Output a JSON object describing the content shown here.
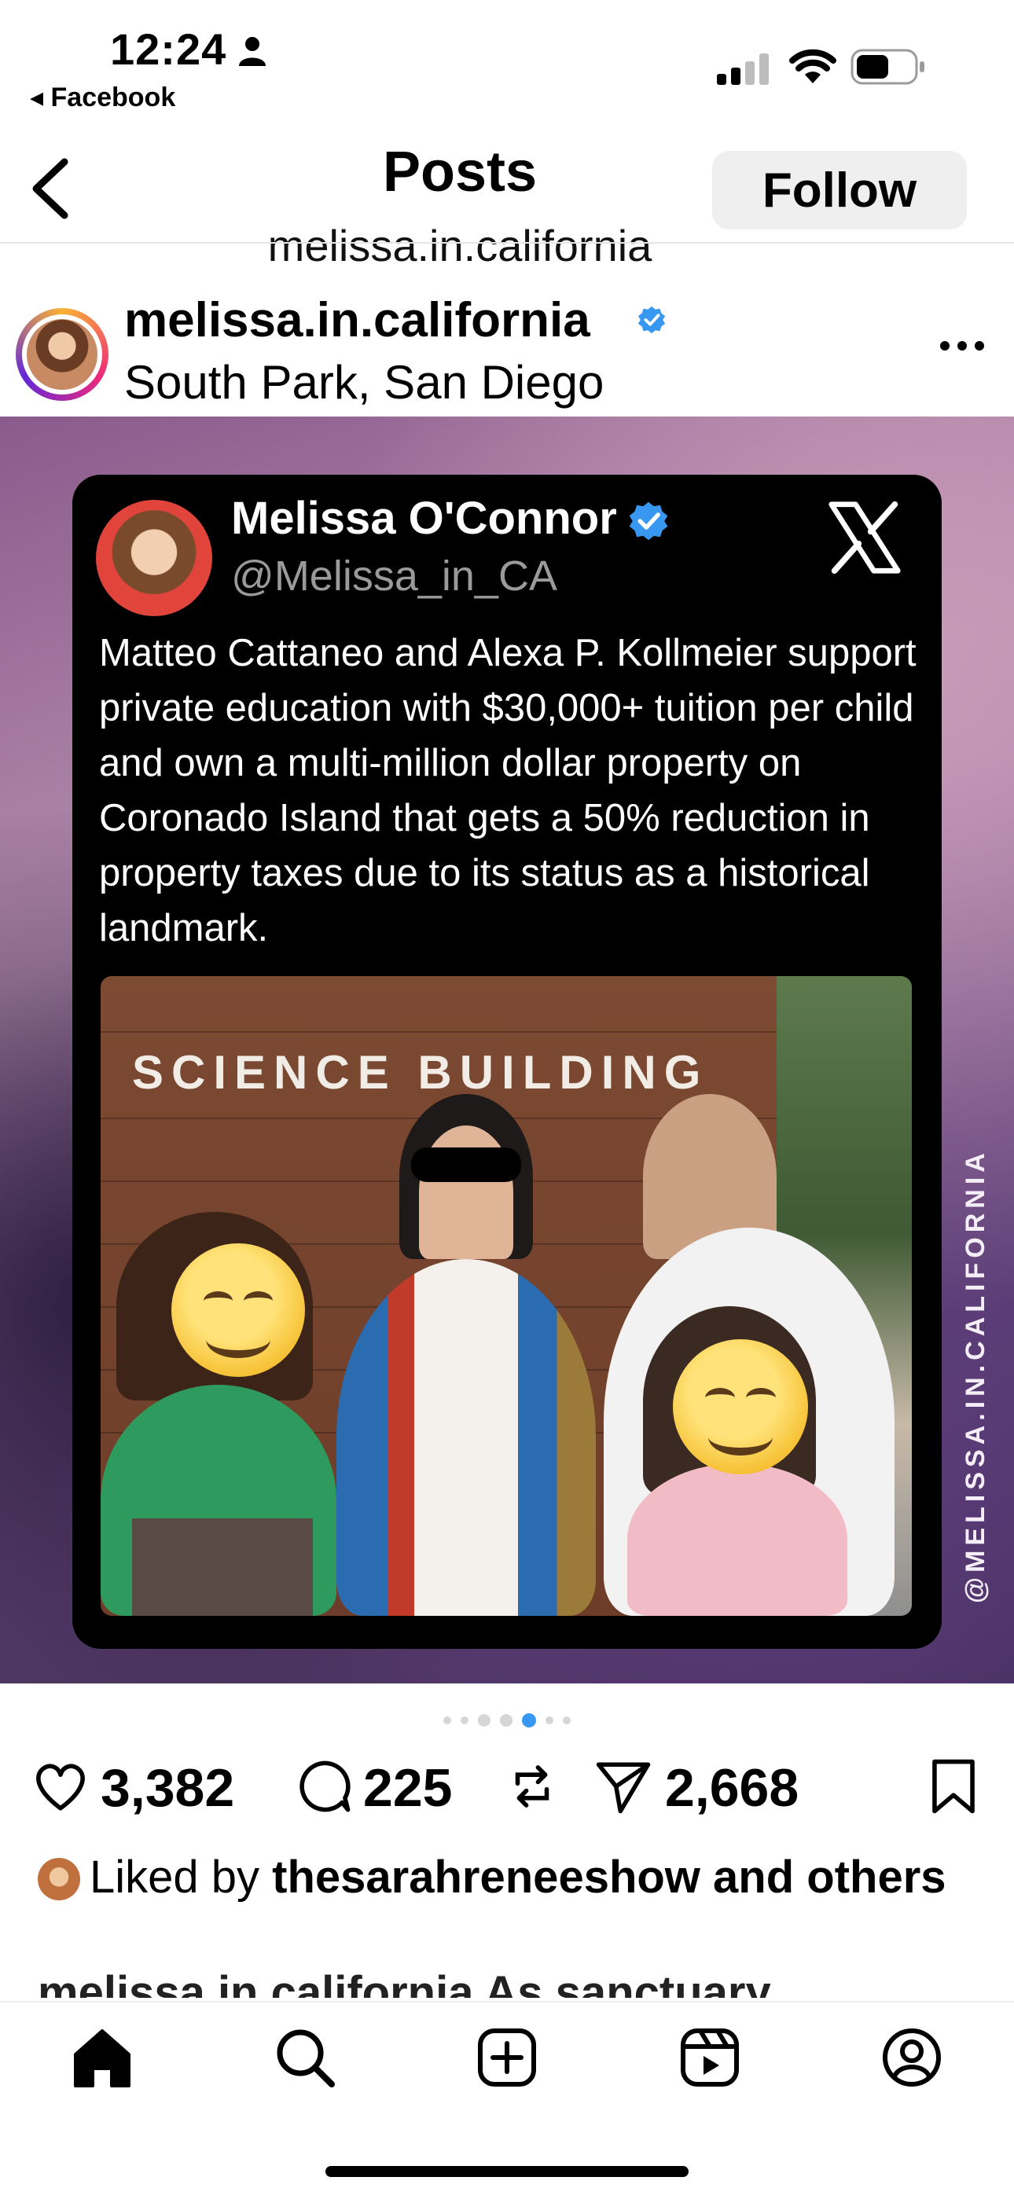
{
  "status_bar": {
    "time": "12:24",
    "back_app": "Facebook"
  },
  "header": {
    "title": "Posts",
    "subtitle": "melissa.in.california",
    "follow_label": "Follow"
  },
  "post": {
    "username": "melissa.in.california",
    "location": "South Park, San Diego",
    "tweet": {
      "name": "Melissa O'Connor",
      "handle": "@Melissa_in_CA",
      "text": "Matteo Cattaneo and Alexa P. Kollmeier support private education with $30,000+ tuition per child and own a multi-million dollar property on Coronado Island that gets a 50% reduction in property taxes due to its status as a historical landmark.",
      "photo_sign": "SCIENCE BUILDING"
    },
    "watermark": "@MELISSA.IN.CALIFORNIA",
    "carousel": {
      "count": 7,
      "active": 4
    },
    "likes": "3,382",
    "comments": "225",
    "shares": "2,668",
    "liked_by_prefix": "Liked by ",
    "liked_by_user": "thesarahreneeshow",
    "liked_by_suffix": " and others",
    "caption_cut": "melissa.in.california As sanctuary"
  },
  "colors": {
    "accent": "#3897f0",
    "verified": "#3897f0"
  },
  "icons": [
    "back-chevron-icon",
    "person-icon",
    "signal-icon",
    "wifi-icon",
    "battery-icon",
    "verified-icon",
    "more-icon",
    "x-logo-icon",
    "heart-icon",
    "comment-icon",
    "repost-icon",
    "send-icon",
    "bookmark-icon",
    "home-icon",
    "search-icon",
    "create-icon",
    "reels-icon",
    "profile-icon"
  ]
}
